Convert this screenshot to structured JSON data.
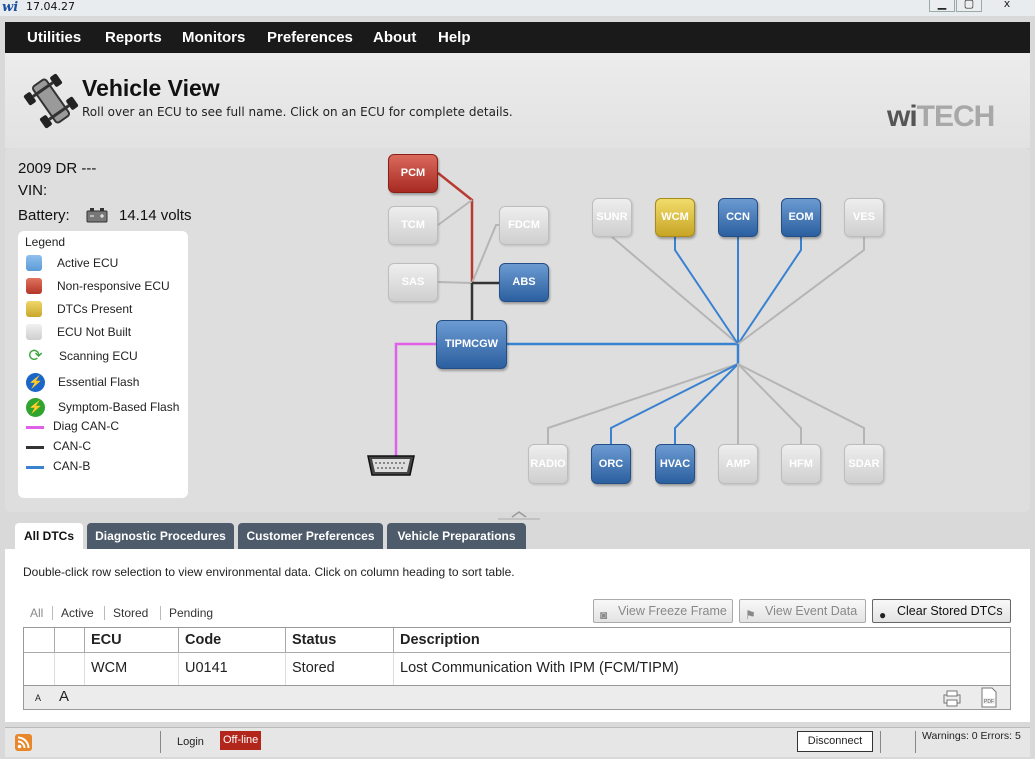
{
  "window": {
    "logo": "wi",
    "title": "17.04.27",
    "minimize": "▁",
    "maximize": "▢",
    "close": "x"
  },
  "menu": [
    "Utilities",
    "Reports",
    "Monitors",
    "Preferences",
    "About",
    "Help"
  ],
  "header": {
    "title": "Vehicle View",
    "subtitle": "Roll over an ECU to see full name. Click on an ECU for complete details.",
    "brand_a": "wi",
    "brand_b": "TECH"
  },
  "vehicle": {
    "model": "2009 DR ---",
    "vin_label": "VIN:",
    "battery_label": "Battery:",
    "battery_value": "14.14 volts"
  },
  "legend": {
    "title": "Legend",
    "items": [
      {
        "label": "Active ECU",
        "color": "#5b9bd5"
      },
      {
        "label": "Non-responsive ECU",
        "color": "#c0392b"
      },
      {
        "label": "DTCs Present",
        "color": "#d4b437"
      },
      {
        "label": "ECU Not Built",
        "color": "#d3d3d3"
      },
      {
        "label": "Scanning ECU",
        "color": "#3aa63a"
      },
      {
        "label": "Essential Flash",
        "color": "#1b66c9"
      },
      {
        "label": "Symptom-Based Flash",
        "color": "#2fa52f"
      }
    ],
    "lines": [
      {
        "label": "Diag CAN-C",
        "color": "#e060e8"
      },
      {
        "label": "CAN-C",
        "color": "#333333"
      },
      {
        "label": "CAN-B",
        "color": "#3a82d0"
      }
    ]
  },
  "ecus": {
    "pcm": "PCM",
    "tcm": "TCM",
    "fdcm": "FDCM",
    "sas": "SAS",
    "abs": "ABS",
    "tipmcgw": "TIPMCGW",
    "sunr": "SUNR",
    "wcm": "WCM",
    "ccn": "CCN",
    "eom": "EOM",
    "ves": "VES",
    "radio": "RADIO",
    "orc": "ORC",
    "hvac": "HVAC",
    "amp": "AMP",
    "hfm": "HFM",
    "sdar": "SDAR"
  },
  "tabs": [
    "All DTCs",
    "Diagnostic Procedures",
    "Customer Preferences",
    "Vehicle Preparations"
  ],
  "dtc": {
    "instructions": "Double-click row selection to view environmental data.  Click on column heading to sort table.",
    "filters": [
      "All",
      "Active",
      "Stored",
      "Pending"
    ],
    "buttons": {
      "freeze": "View Freeze Frame",
      "event": "View Event Data",
      "clear": "Clear Stored DTCs"
    },
    "columns": [
      "ECU",
      "Code",
      "Status",
      "Description"
    ],
    "rows": [
      {
        "ecu": "WCM",
        "code": "U0141",
        "status": "Stored",
        "description": "Lost Communication With IPM (FCM/TIPM)"
      }
    ],
    "font_small": "A",
    "font_large": "A"
  },
  "statusbar": {
    "login": "Login",
    "offline": "Off-line",
    "disconnect": "Disconnect",
    "warnings": "Warnings: 0 Errors: 5"
  }
}
